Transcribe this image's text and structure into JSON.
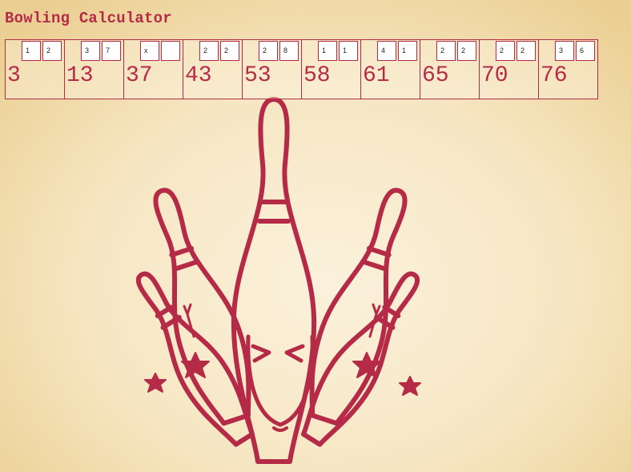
{
  "app": {
    "title": "Bowling Calculator"
  },
  "colors": {
    "accent": "#b52a47",
    "background": "#f6e6c2"
  },
  "frames": [
    {
      "roll1": "1",
      "roll2": "2",
      "total": "3"
    },
    {
      "roll1": "3",
      "roll2": "7",
      "total": "13"
    },
    {
      "roll1": "x",
      "roll2": "",
      "total": "37"
    },
    {
      "roll1": "2",
      "roll2": "2",
      "total": "43"
    },
    {
      "roll1": "2",
      "roll2": "8",
      "total": "53"
    },
    {
      "roll1": "1",
      "roll2": "1",
      "total": "58"
    },
    {
      "roll1": "4",
      "roll2": "1",
      "total": "61"
    },
    {
      "roll1": "2",
      "roll2": "2",
      "total": "65"
    },
    {
      "roll1": "2",
      "roll2": "2",
      "total": "70"
    },
    {
      "roll1": "3",
      "roll2": "6",
      "total": "76"
    }
  ],
  "logo": {
    "icon": "bowling-pins-logo"
  }
}
